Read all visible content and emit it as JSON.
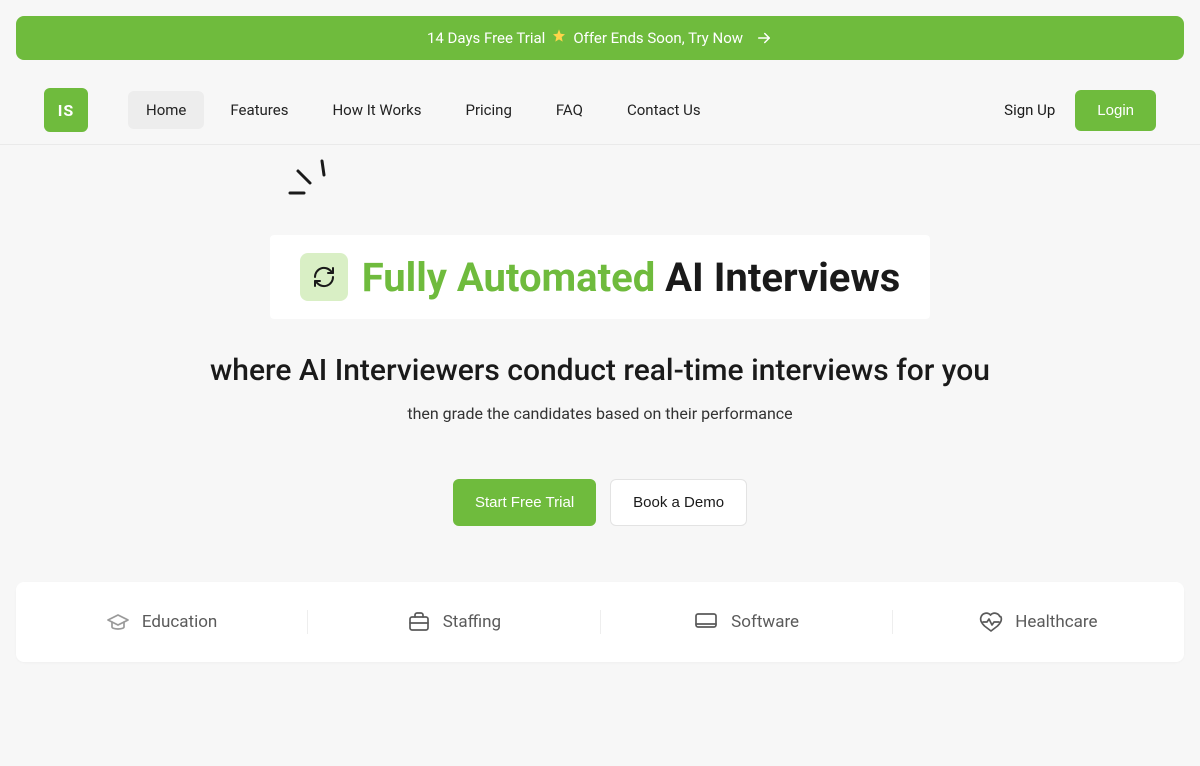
{
  "promo": {
    "text_before": "14 Days Free Trial",
    "text_after": "Offer Ends Soon, Try Now",
    "star_icon": "star-icon",
    "arrow_icon": "arrow-right-icon"
  },
  "nav": {
    "logo_text": "IS",
    "links": [
      {
        "label": "Home",
        "active": true
      },
      {
        "label": "Features",
        "active": false
      },
      {
        "label": "How It Works",
        "active": false
      },
      {
        "label": "Pricing",
        "active": false
      },
      {
        "label": "FAQ",
        "active": false
      },
      {
        "label": "Contact Us",
        "active": false
      }
    ],
    "signup_label": "Sign Up",
    "login_label": "Login"
  },
  "hero": {
    "pill_highlight": "Fully Automated",
    "pill_rest": " AI Interviews",
    "pill_icon": "cycle-icon",
    "subhead": "where AI Interviewers conduct real-time interviews for you",
    "tagline": "then grade the candidates based on their performance",
    "cta_primary": "Start Free Trial",
    "cta_secondary": "Book a Demo"
  },
  "categories": [
    {
      "icon": "education-icon",
      "label": "Education"
    },
    {
      "icon": "briefcase-icon",
      "label": "Staffing"
    },
    {
      "icon": "monitor-icon",
      "label": "Software"
    },
    {
      "icon": "heart-pulse-icon",
      "label": "Healthcare"
    }
  ],
  "colors": {
    "accent": "#6fbb3d",
    "accent_light": "#d9efc5",
    "bg": "#f7f7f7"
  }
}
